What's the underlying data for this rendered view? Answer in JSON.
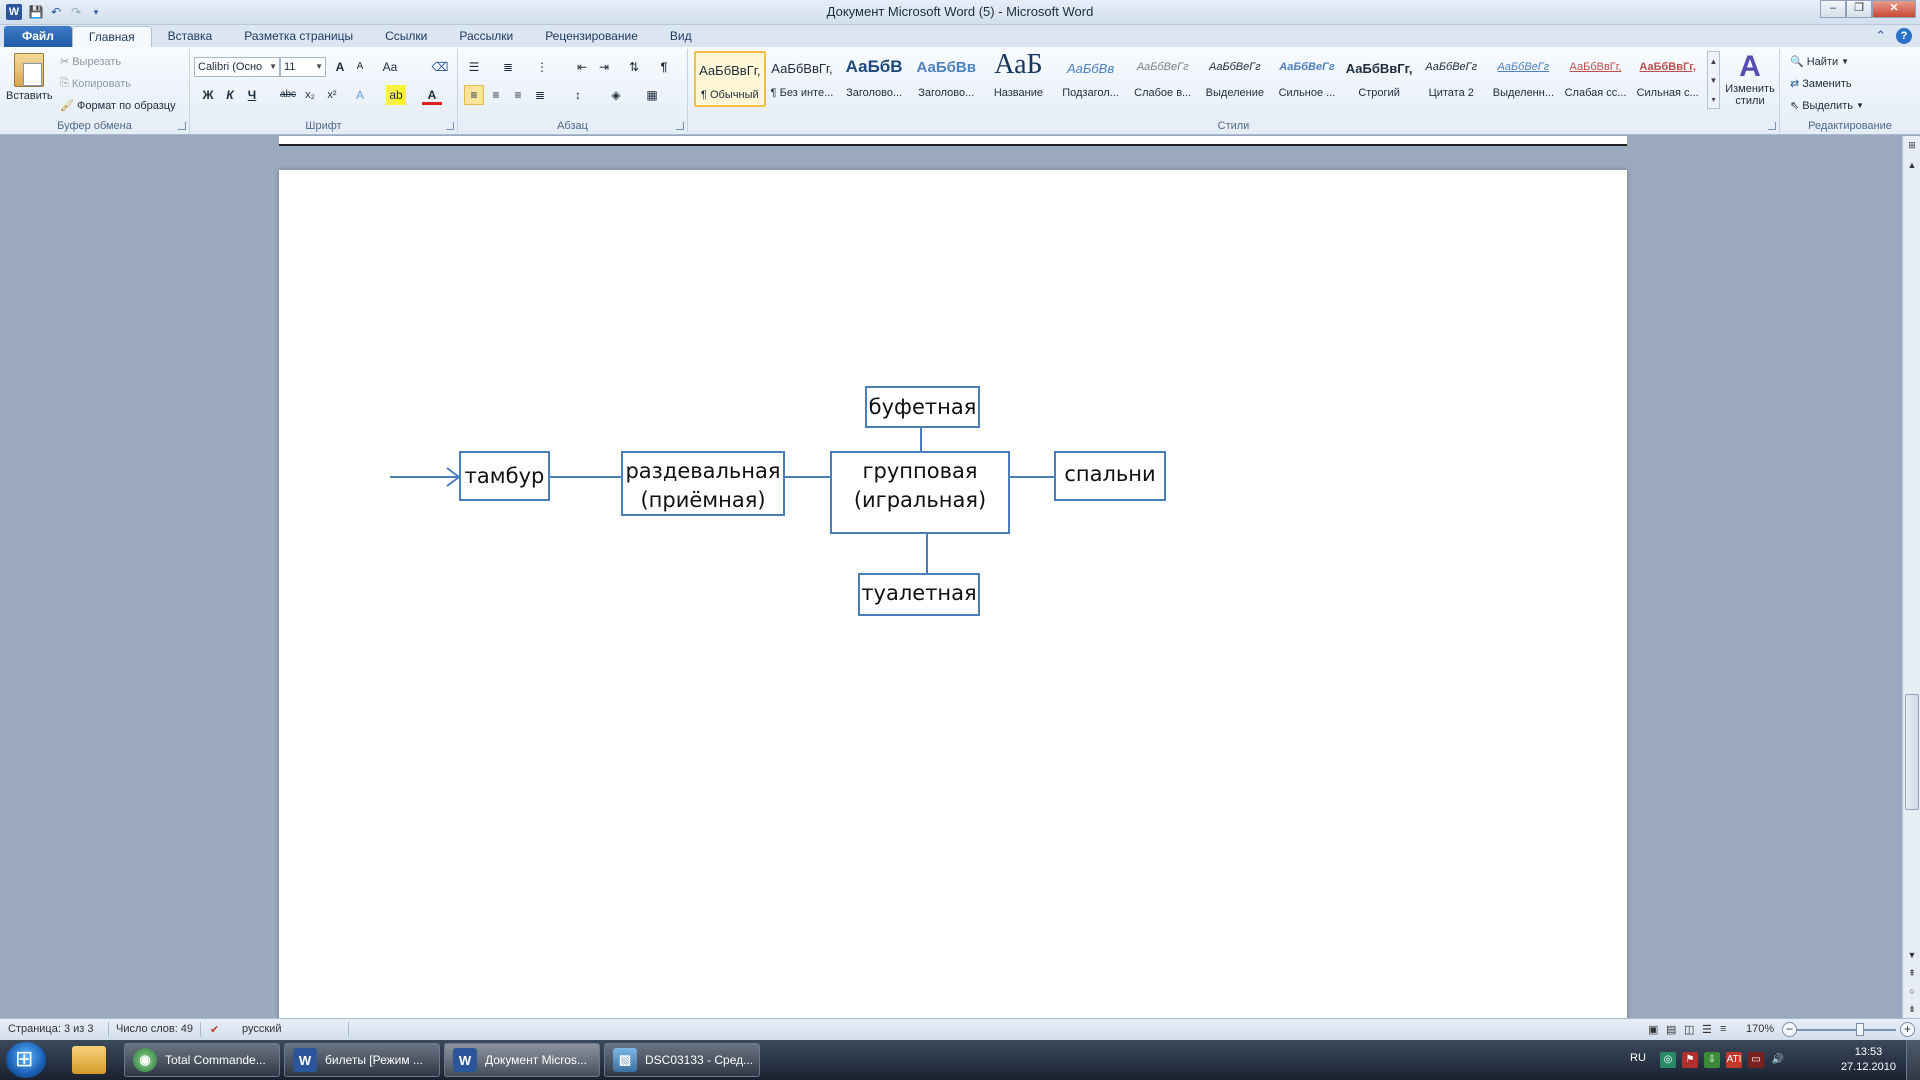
{
  "window": {
    "title": "Документ Microsoft Word (5)  -  Microsoft Word",
    "app_icon": "W"
  },
  "tabs": [
    {
      "label": "Файл"
    },
    {
      "label": "Главная"
    },
    {
      "label": "Вставка"
    },
    {
      "label": "Разметка страницы"
    },
    {
      "label": "Ссылки"
    },
    {
      "label": "Рассылки"
    },
    {
      "label": "Рецензирование"
    },
    {
      "label": "Вид"
    }
  ],
  "ribbon": {
    "clipboard": {
      "label": "Буфер обмена",
      "paste": "Вставить",
      "cut": "Вырезать",
      "copy": "Копировать",
      "format_painter": "Формат по образцу"
    },
    "font": {
      "label": "Шрифт",
      "font_name": "Calibri (Осно",
      "font_size": "11",
      "bold": "Ж",
      "italic": "К",
      "underline": "Ч",
      "strike": "abc",
      "subscript": "x₂",
      "superscript": "x²",
      "grow": "A",
      "shrink": "A",
      "case": "Aa",
      "font_color": "A"
    },
    "paragraph": {
      "label": "Абзац",
      "pilcrow": "¶"
    },
    "styles": {
      "label": "Стили",
      "items": [
        {
          "preview": "АаБбВвГг,",
          "name": "¶ Обычный"
        },
        {
          "preview": "АаБбВвГг,",
          "name": "¶ Без инте..."
        },
        {
          "preview": "АаБбВ",
          "name": "Заголово..."
        },
        {
          "preview": "АаБбВв",
          "name": "Заголово..."
        },
        {
          "preview": "АаБ",
          "name": "Название"
        },
        {
          "preview": "АаБбВв",
          "name": "Подзагол..."
        },
        {
          "preview": "АаБбВеГг",
          "name": "Слабое в..."
        },
        {
          "preview": "АаБбВеГг",
          "name": "Выделение"
        },
        {
          "preview": "АаБбВеГг",
          "name": "Сильное ..."
        },
        {
          "preview": "АаБбВвГг,",
          "name": "Строгий"
        },
        {
          "preview": "АаБбВеГг",
          "name": "Цитата 2"
        },
        {
          "preview": "АаБбВеГг",
          "name": "Выделенн..."
        },
        {
          "preview": "АаБбВвГг,",
          "name": "Слабая сс..."
        },
        {
          "preview": "АаБбВвГг,",
          "name": "Сильная с..."
        }
      ],
      "change_styles": "Изменить стили"
    },
    "editing": {
      "label": "Редактирование",
      "find": "Найти",
      "replace": "Заменить",
      "select": "Выделить"
    }
  },
  "diagram": {
    "boxes": {
      "tambur": "тамбур",
      "razdev_line1": "раздевальная",
      "razdev_line2": "(приёмная)",
      "gruppa_line1": "групповая",
      "gruppa_line2": "(игральная)",
      "bufet": "буфетная",
      "spalni": "спальни",
      "tualet": "туалетная"
    },
    "line_color": "#4a7ebb"
  },
  "statusbar": {
    "page": "Страница: 3 из 3",
    "words": "Число слов: 49",
    "language": "русский",
    "zoom": "170%"
  },
  "taskbar": {
    "tasks": [
      {
        "label": "Total Commande..."
      },
      {
        "label": "билеты [Режим ..."
      },
      {
        "label": "Документ Micros..."
      },
      {
        "label": "DSC03133 - Сред..."
      }
    ],
    "lang": "RU",
    "time": "13:53",
    "date": "27.12.2010"
  }
}
